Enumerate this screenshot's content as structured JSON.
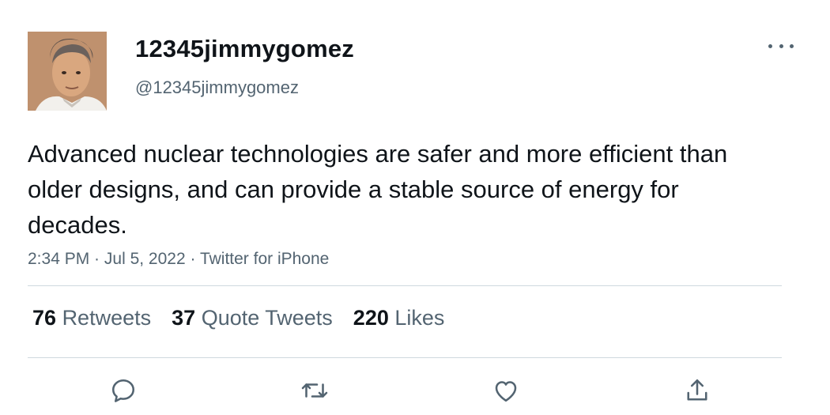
{
  "author": {
    "display_name": "12345jimmygomez",
    "handle": "@12345jimmygomez"
  },
  "tweet": {
    "text": "Advanced nuclear technologies are safer and more efficient than older designs, and can provide a stable source of energy for decades.",
    "time": "2:34 PM",
    "date": "Jul 5, 2022",
    "source": "Twitter for iPhone",
    "separator": " · "
  },
  "stats": {
    "retweets_count": "76",
    "retweets_label": "Retweets",
    "quotes_count": "37",
    "quotes_label": "Quote Tweets",
    "likes_count": "220",
    "likes_label": "Likes"
  },
  "actions": [
    "reply-icon",
    "retweet-icon",
    "like-icon",
    "share-icon"
  ],
  "colors": {
    "text": "#0f1419",
    "secondary": "#536471",
    "divider": "#cfd9de"
  }
}
